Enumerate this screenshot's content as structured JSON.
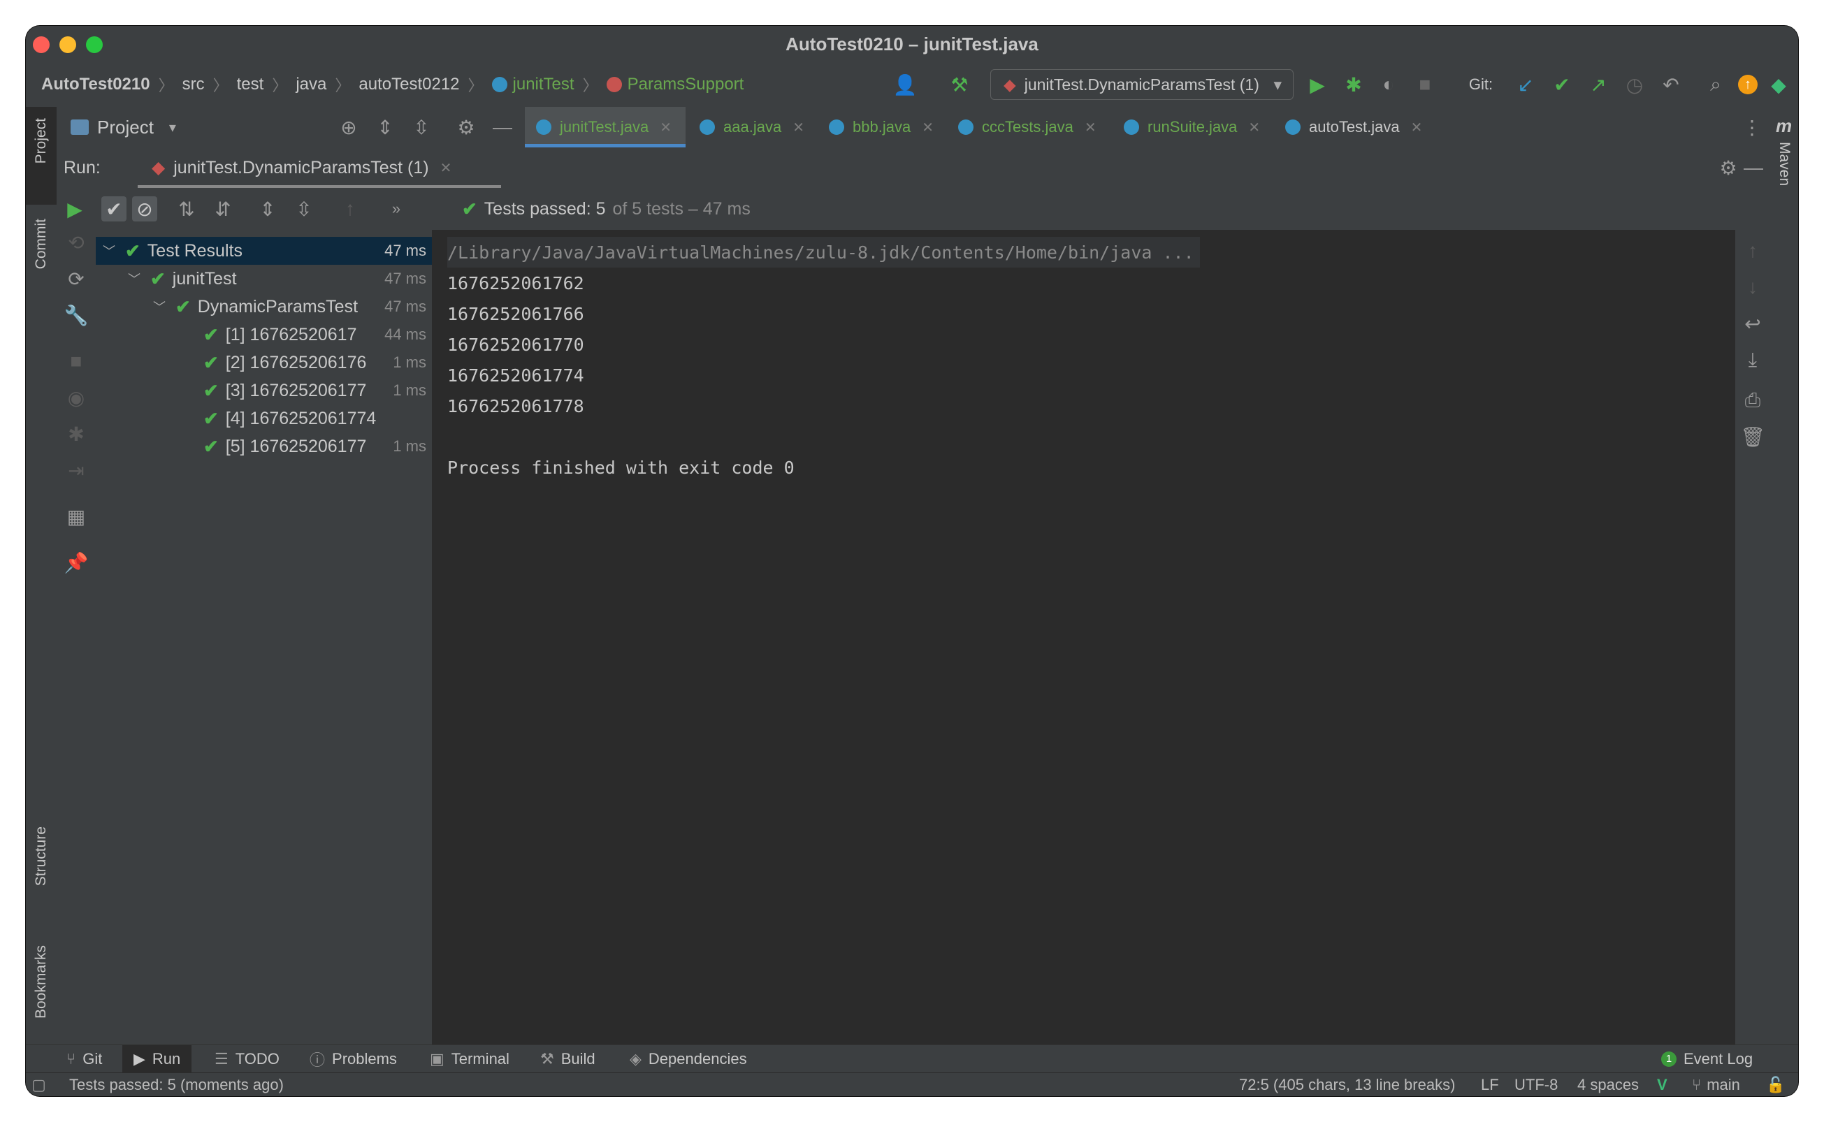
{
  "window": {
    "title": "AutoTest0210 – junitTest.java"
  },
  "breadcrumb": [
    "AutoTest0210",
    "src",
    "test",
    "java",
    "autoTest0212",
    "junitTest",
    "ParamsSupport"
  ],
  "run_config": "junitTest.DynamicParamsTest (1)",
  "git_label": "Git:",
  "project_panel": {
    "label": "Project"
  },
  "editor_tabs": [
    {
      "label": "junitTest.java",
      "active": true
    },
    {
      "label": "aaa.java"
    },
    {
      "label": "bbb.java"
    },
    {
      "label": "cccTests.java"
    },
    {
      "label": "runSuite.java"
    },
    {
      "label": "autoTest.java"
    }
  ],
  "left_strip": [
    "Project",
    "Commit",
    "Structure",
    "Bookmarks"
  ],
  "right_strip": [
    "Maven"
  ],
  "run_panel": {
    "label": "Run:",
    "tab": "junitTest.DynamicParamsTest (1)",
    "status_passed": "Tests passed: 5",
    "status_rest": "of 5 tests – 47 ms"
  },
  "tree": [
    {
      "label": "Test Results",
      "duration": "47 ms",
      "level": 0,
      "expand": true
    },
    {
      "label": "junitTest",
      "duration": "47 ms",
      "level": 1,
      "expand": true
    },
    {
      "label": "DynamicParamsTest",
      "duration": "47 ms",
      "level": 2,
      "expand": true
    },
    {
      "label": "[1] 16762520617",
      "duration": "44 ms",
      "level": 3
    },
    {
      "label": "[2] 167625206176",
      "duration": "1 ms",
      "level": 3
    },
    {
      "label": "[3] 167625206177",
      "duration": "1 ms",
      "level": 3
    },
    {
      "label": "[4] 1676252061774",
      "duration": "",
      "level": 3
    },
    {
      "label": "[5] 167625206177",
      "duration": "1 ms",
      "level": 3
    }
  ],
  "console": [
    "/Library/Java/JavaVirtualMachines/zulu-8.jdk/Contents/Home/bin/java ...",
    "1676252061762",
    "1676252061766",
    "1676252061770",
    "1676252061774",
    "1676252061778",
    "",
    "Process finished with exit code 0"
  ],
  "bottom_tabs": [
    "Git",
    "Run",
    "TODO",
    "Problems",
    "Terminal",
    "Build",
    "Dependencies"
  ],
  "event_log": {
    "label": "Event Log",
    "count": "1"
  },
  "status": {
    "message": "Tests passed: 5 (moments ago)",
    "position": "72:5 (405 chars, 13 line breaks)",
    "line_sep": "LF",
    "encoding": "UTF-8",
    "indent": "4 spaces",
    "branch": "main"
  }
}
